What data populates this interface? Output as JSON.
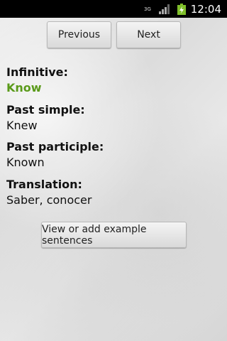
{
  "status_bar": {
    "network_type": "3G",
    "time": "12:04",
    "icons": [
      "network-3g-icon",
      "signal-icon",
      "battery-charging-icon"
    ]
  },
  "nav": {
    "previous_label": "Previous",
    "next_label": "Next"
  },
  "verb": {
    "infinitive_label": "Infinitive:",
    "infinitive_value": "Know",
    "past_simple_label": "Past simple:",
    "past_simple_value": "Knew",
    "past_participle_label": "Past participle:",
    "past_participle_value": "Known",
    "translation_label": "Translation:",
    "translation_value": "Saber, conocer"
  },
  "actions": {
    "examples_label": "View or add example sentences"
  },
  "colors": {
    "infinitive_accent": "#5a9a1a"
  }
}
